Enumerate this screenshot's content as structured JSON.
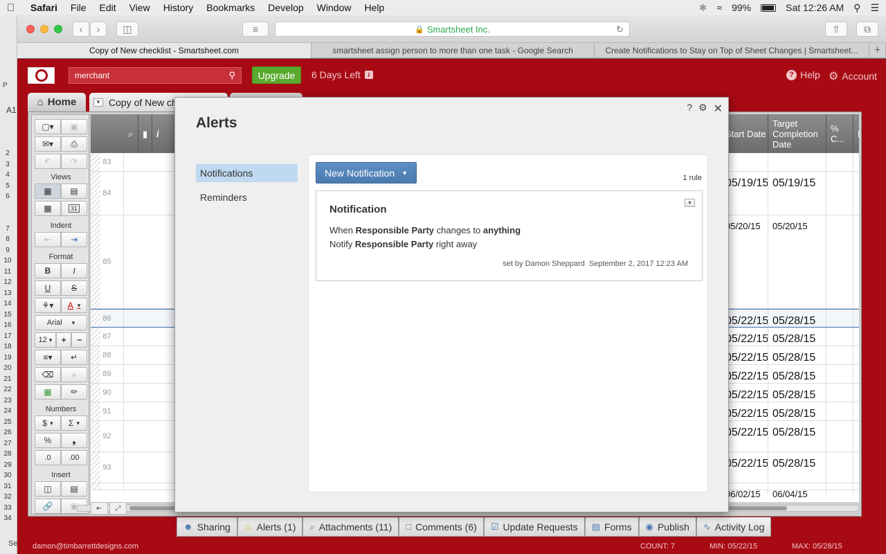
{
  "menubar": {
    "items": [
      "Safari",
      "File",
      "Edit",
      "View",
      "History",
      "Bookmarks",
      "Develop",
      "Window",
      "Help"
    ],
    "battery": "99%",
    "clock": "Sat 12:26 AM"
  },
  "browser": {
    "address": "Smartsheet Inc.",
    "tabs": [
      "Copy of New checklist - Smartsheet.com",
      "smartsheet assign person to more than one task - Google Search",
      "Create Notifications to Stay on Top of Sheet Changes | Smartsheet..."
    ]
  },
  "spreadsheet_left": {
    "cell_ref": "A1",
    "row_numbers": [
      "2",
      "3",
      "4",
      "5",
      "6",
      "",
      "",
      "7",
      "8",
      "9",
      "10",
      "11",
      "12",
      "13",
      "14",
      "15",
      "16",
      "17",
      "18",
      "19",
      "20",
      "21",
      "22",
      "23",
      "24",
      "25",
      "26",
      "27",
      "28",
      "29",
      "30",
      "31",
      "32",
      "33",
      "34"
    ],
    "letters": [
      "P",
      "Se"
    ]
  },
  "header": {
    "search_value": "merchant",
    "upgrade_label": "Upgrade",
    "days_left": "6 Days Left",
    "info_badge": "i",
    "help_label": "Help",
    "account_label": "Account"
  },
  "tabs": {
    "home_label": "Home",
    "sheet_label": "Copy of New checklist"
  },
  "toolbar": {
    "views_label": "Views",
    "indent_label": "Indent",
    "format_label": "Format",
    "numbers_label": "Numbers",
    "insert_label": "Insert",
    "font_name": "Arial",
    "font_size": "12",
    "bold": "B",
    "italic": "I",
    "underline": "U",
    "strike": "S",
    "text_color": "A",
    "currency": "$",
    "sum": "Σ",
    "percent": "%",
    "comma": "❟",
    "dec_less": ".0",
    "dec_more": ".00",
    "cal_day": "31"
  },
  "grid": {
    "columns": [
      "Start Date",
      "Target Completion Date",
      "% C...",
      "Pre"
    ],
    "rows": [
      {
        "num": "83",
        "start": "",
        "target": "",
        "small": false
      },
      {
        "num": "84",
        "start": "05/19/15",
        "target": "05/19/15",
        "small": false
      },
      {
        "num": "85",
        "start": "05/20/15",
        "target": "05/20/15",
        "small": true
      },
      {
        "num": "86",
        "start": "05/22/15",
        "target": "05/28/15",
        "small": false
      },
      {
        "num": "87",
        "start": "05/22/15",
        "target": "05/28/15",
        "small": false
      },
      {
        "num": "88",
        "start": "05/22/15",
        "target": "05/28/15",
        "small": false
      },
      {
        "num": "89",
        "start": "05/22/15",
        "target": "05/28/15",
        "small": false
      },
      {
        "num": "90",
        "start": "05/22/15",
        "target": "05/28/15",
        "small": false
      },
      {
        "num": "91",
        "start": "05/22/15",
        "target": "05/28/15",
        "small": false
      },
      {
        "num": "92",
        "start": "05/22/15",
        "target": "05/28/15",
        "small": false
      },
      {
        "num": "93",
        "start": "05/22/15",
        "target": "05/28/15",
        "small": false
      },
      {
        "num": "",
        "start": "06/02/15",
        "target": "06/04/15",
        "small": true
      }
    ]
  },
  "bottom_tabs": [
    {
      "label": "Sharing",
      "icon": "users-icon"
    },
    {
      "label": "Alerts (1)",
      "icon": "bell-icon"
    },
    {
      "label": "Attachments (11)",
      "icon": "paperclip-icon"
    },
    {
      "label": "Comments (6)",
      "icon": "comment-icon"
    },
    {
      "label": "Update Requests",
      "icon": "update-request-icon"
    },
    {
      "label": "Forms",
      "icon": "form-icon"
    },
    {
      "label": "Publish",
      "icon": "globe-icon"
    },
    {
      "label": "Activity Log",
      "icon": "activity-icon"
    }
  ],
  "status": {
    "user_email": "damon@timbarrettdesigns.com",
    "count": "COUNT: 7",
    "min": "MIN: 05/22/15",
    "max": "MAX: 05/28/15"
  },
  "dialog": {
    "title": "Alerts",
    "help_icon": "?",
    "nav": [
      "Notifications",
      "Reminders"
    ],
    "new_button": "New Notification",
    "rule_count": "1 rule",
    "card": {
      "title": "Notification",
      "when_prefix": "When",
      "when_field": "Responsible Party",
      "when_middle": "changes to",
      "when_value": "anything",
      "notify_prefix": "Notify",
      "notify_field": "Responsible Party",
      "notify_suffix": "right away",
      "set_by": "set by Damon Sheppard",
      "date": "September 2, 2017 12:23 AM"
    }
  },
  "colors": {
    "app_red": "#a80a14",
    "upgrade_green": "#5aaa2e",
    "button_blue": "#4a7aae",
    "nav_active": "#bfdaf0"
  }
}
